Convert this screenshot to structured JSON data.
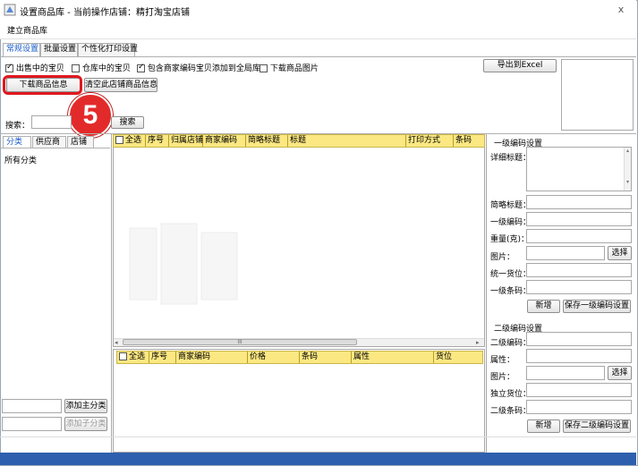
{
  "window": {
    "title": "设置商品库 - 当前操作店铺：精打淘宝店铺",
    "close": "x"
  },
  "menu": {
    "item1": "建立商品库"
  },
  "tabs": [
    "常规设置",
    "批量设置",
    "个性化打印设置"
  ],
  "options": {
    "on_sale": "出售中的宝贝",
    "in_warehouse": "仓库中的宝贝",
    "include_coded": "包含商家编码宝贝添加到全局库",
    "download_images": "下载商品图片"
  },
  "buttons": {
    "download_info": "下载商品信息",
    "clear_info": "清空此店铺商品信息",
    "export_excel": "导出到Excel",
    "search": "搜索",
    "add_main_category": "添加主分类",
    "add_sub_category": "添加子分类",
    "new1": "新增",
    "save_level1": "保存一级编码设置",
    "select1": "选择",
    "new2": "新增",
    "save_level2": "保存二级编码设置",
    "select2": "选择"
  },
  "search": {
    "label": "搜索：",
    "value": ""
  },
  "step_badge": "5",
  "left_tabs": [
    "分类",
    "供应商",
    "店铺"
  ],
  "tree": {
    "root": "所有分类"
  },
  "grid1": {
    "columns": [
      "全选",
      "序号",
      "归属店铺",
      "商家编码",
      "简略标题",
      "标题",
      "打印方式",
      "条码"
    ]
  },
  "grid2": {
    "columns": [
      "全选",
      "序号",
      "商家编码",
      "价格",
      "条码",
      "属性",
      "货位"
    ]
  },
  "scroll_grip": "III",
  "level1": {
    "heading": "一级编码设置",
    "detail_title": "详细标题：",
    "short_title": "简略标题：",
    "code": "一级编码：",
    "weight": "重量(克)：",
    "image": "图片：",
    "location": "统一货位：",
    "barcode": "一级条码："
  },
  "level2": {
    "heading": "二级编码设置",
    "code": "二级编码：",
    "attr": "属性：",
    "image": "图片：",
    "location": "独立货位：",
    "barcode": "二级条码："
  },
  "colors": {
    "accent": "#1a5cc8",
    "highlight": "#e0171f",
    "header": "#fbe882",
    "status": "#2e5fae"
  }
}
